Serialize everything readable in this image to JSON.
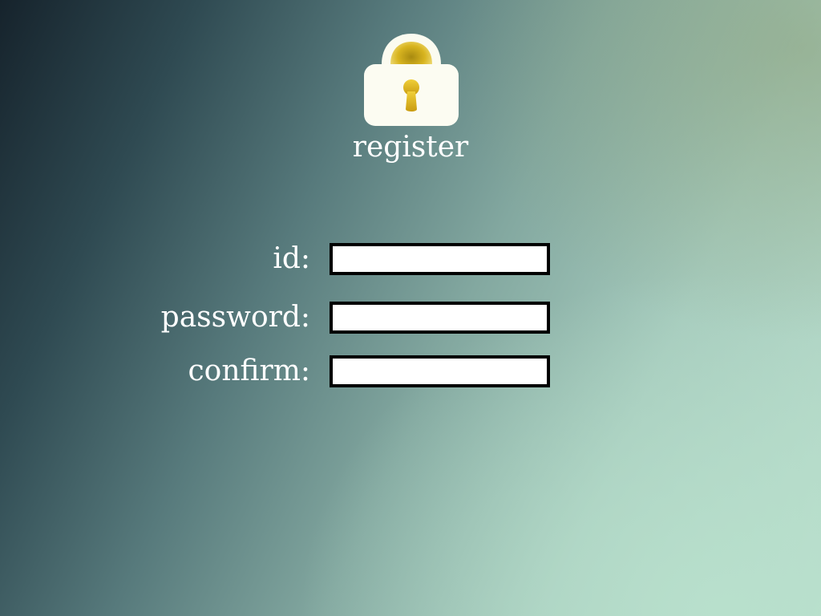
{
  "header": {
    "icon": "lock-icon",
    "title": "register"
  },
  "form": {
    "fields": [
      {
        "label": "id:",
        "value": "",
        "placeholder": ""
      },
      {
        "label": "password:",
        "value": "",
        "placeholder": ""
      },
      {
        "label": "confirm:",
        "value": "",
        "placeholder": ""
      }
    ]
  },
  "colors": {
    "text": "#ffffff",
    "field_border": "#000000",
    "field_background": "#ffffff",
    "lock_gold": "#d9b520"
  }
}
